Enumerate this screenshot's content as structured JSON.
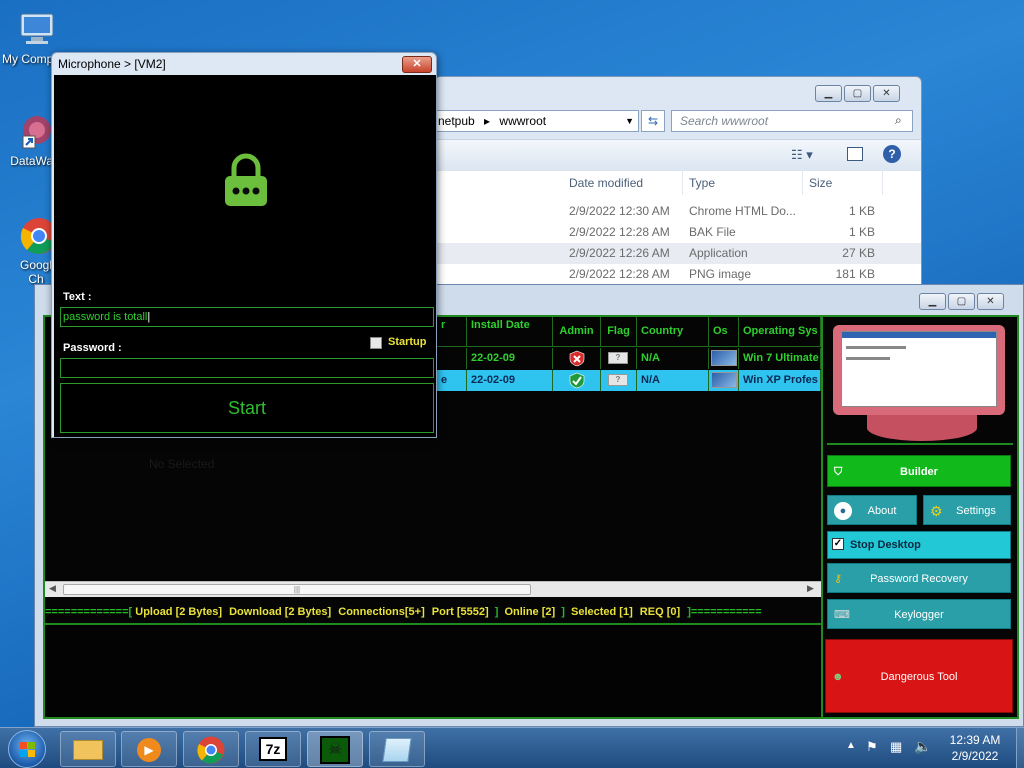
{
  "desktop": {
    "icons": [
      {
        "label": "My Comp",
        "icon": "computer-icon"
      },
      {
        "label": "DataWag",
        "icon": "shortcut-icon"
      },
      {
        "label": "Googl Ch",
        "icon": "chrome-icon"
      }
    ]
  },
  "explorer": {
    "address_part1": "netpub",
    "address_part2": "wwwroot",
    "search_placeholder": "Search wwwroot",
    "columns": [
      "Date modified",
      "Type",
      "Size"
    ],
    "rows": [
      {
        "date": "2/9/2022 12:30 AM",
        "type": "Chrome HTML Do...",
        "size": "1 KB"
      },
      {
        "date": "2/9/2022 12:28 AM",
        "type": "BAK File",
        "size": "1 KB"
      },
      {
        "date": "2/9/2022 12:26 AM",
        "type": "Application",
        "size": "27 KB"
      },
      {
        "date": "2/9/2022 12:28 AM",
        "type": "PNG image",
        "size": "181 KB"
      }
    ]
  },
  "mic_window": {
    "title": "Microphone > [VM2]",
    "text_label": "Text :",
    "text_value": "password is totall",
    "password_label": "Password :",
    "startup_label": "Startup",
    "start_label": "Start"
  },
  "rat": {
    "headers": [
      "r",
      "Install Date",
      "Admin",
      "Flag",
      "Country",
      "Os",
      "Operating Sys"
    ],
    "rows": [
      {
        "date": "22-02-09",
        "admin": "no",
        "country": "N/A",
        "os": "Win 7 Ultimate"
      },
      {
        "date": "22-02-09",
        "admin": "yes",
        "country": "N/A",
        "os": "Win XP Profes"
      }
    ],
    "row2_prefix": "e",
    "status": {
      "sep": "=============[",
      "upload": "Upload [2 Bytes]",
      "download": "Download [2 Bytes]",
      "connections": "Connections[5+]",
      "port": "Port [5552]",
      "online": "Online [2]",
      "selected": "Selected [1]",
      "req": "REQ [0]",
      "end": "]==========="
    },
    "buttons": {
      "builder": "Builder",
      "about": "About",
      "settings": "Settings",
      "stop_desktop": "Stop Desktop",
      "password_recovery": "Password Recovery",
      "keylogger": "Keylogger",
      "dangerous_tool": "Dangerous Tool"
    },
    "bg_text": "No Selected"
  },
  "taskbar": {
    "time": "12:39 AM",
    "date": "2/9/2022",
    "apps": [
      "folder-icon",
      "media-player-icon",
      "chrome-icon",
      "7zip-icon",
      "rat-icon",
      "notepad-icon"
    ],
    "app_7z": "7z"
  }
}
